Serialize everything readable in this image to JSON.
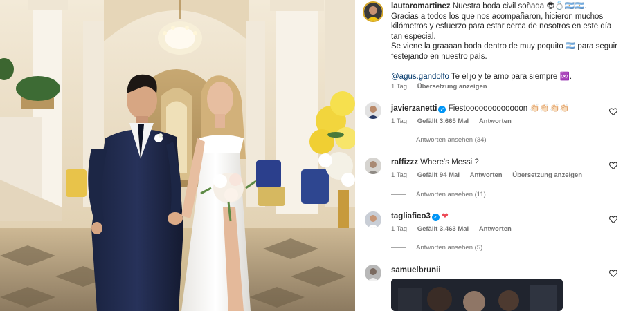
{
  "post": {
    "author": "lautaromartinez",
    "caption_line1": "Nuestra boda civil soñada 😎💍🇦🇷🇦🇷.",
    "caption_line2": "Gracias a todos los que nos acompañaron, hicieron muchos",
    "caption_line3": "kilómetros y esfuerzo para estar cerca de nosotros en este día",
    "caption_line4": "tan especial.",
    "caption_line5": "Se viene la graaaan boda dentro de muy poquito 🇦🇷 para seguir",
    "caption_line6": "festejando en nuestro país.",
    "mention": "@agus.gandolfo",
    "mention_suffix": " Te elijo y te amo para siempre ♾️.",
    "time": "1 Tag",
    "translate": "Übersetzung anzeigen"
  },
  "comments": [
    {
      "user": "javierzanetti",
      "text": " Fiestooooooooooooon 👏🏻👏🏻👏🏻👏🏻",
      "time": "1 Tag",
      "likes": "Gefällt 3.665 Mal",
      "reply": "Antworten",
      "replies": "Antworten ansehen (34)"
    },
    {
      "user": "raffizzz",
      "text": " Where's Messi ?",
      "time": "1 Tag",
      "likes": "Gefällt 94 Mal",
      "reply": "Antworten",
      "translate": "Übersetzung anzeigen",
      "replies": "Antworten ansehen (11)"
    },
    {
      "user": "tagliafico3",
      "text": " ❤",
      "time": "1 Tag",
      "likes": "Gefällt 3.463 Mal",
      "reply": "Antworten",
      "replies": "Antworten ansehen (5)"
    },
    {
      "user": "samuelbrunii"
    }
  ],
  "colors": {
    "verified": "#0095f6",
    "mention": "#00376b",
    "meta": "#737373",
    "heart_red": "#ed4956"
  },
  "icons": [
    "heart-outline-icon",
    "verified-badge-icon",
    "heart-emoji-icon"
  ]
}
